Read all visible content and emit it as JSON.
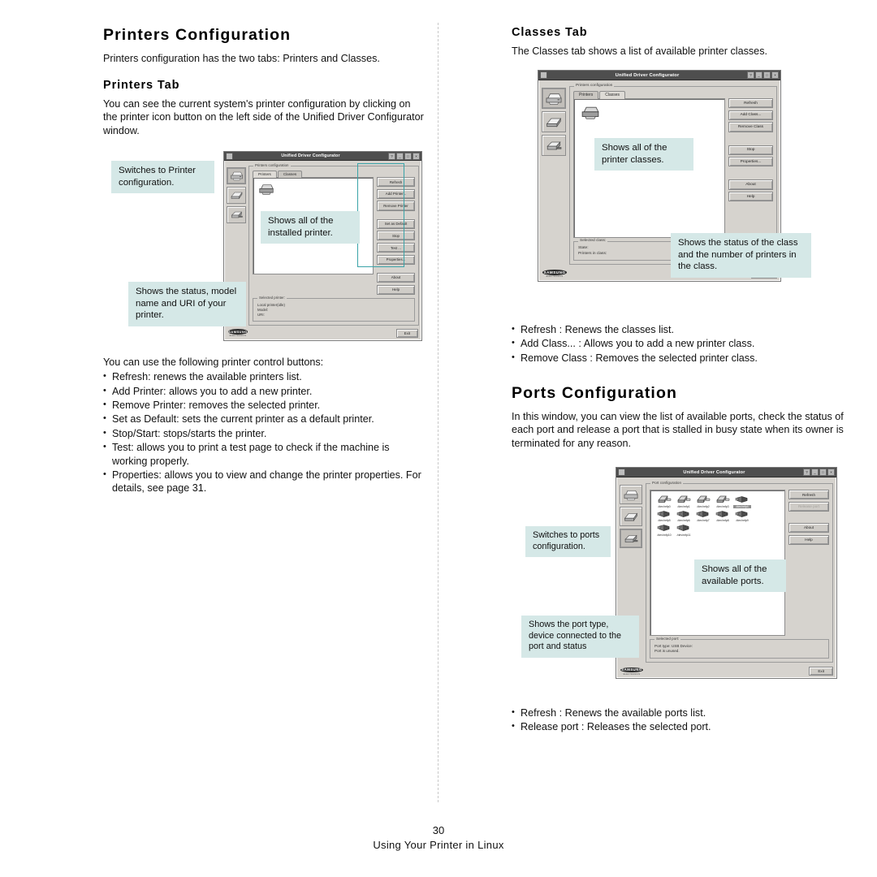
{
  "page": {
    "number": "30",
    "footer_title": "Using Your Printer in Linux"
  },
  "left_column": {
    "heading": "Printers Configuration",
    "intro": "Printers configuration has the two tabs: Printers and Classes.",
    "subheading": "Printers Tab",
    "paragraph": "You can see the current system's printer configuration by clicking on the printer icon button on the left side of the Unified Driver Configurator window.",
    "buttons_intro": "You can use the following printer control buttons:",
    "button_list": [
      "Refresh: renews the available printers list.",
      "Add Printer: allows you to add a new printer.",
      "Remove Printer: removes the selected printer.",
      "Set as Default: sets the current printer as a default printer.",
      "Stop/Start: stops/starts the printer.",
      "Test: allows you to print a test page to check if the machine is working properly.",
      "Properties: allows you to view and change the printer properties. For details, see page 31."
    ]
  },
  "right_column": {
    "classes_heading": "Classes Tab",
    "classes_intro": "The Classes tab shows a list of available printer classes.",
    "classes_list": [
      "Refresh : Renews the classes list.",
      "Add Class... : Allows you to add a new printer class.",
      "Remove Class : Removes the selected printer class."
    ],
    "ports_heading": "Ports Configuration",
    "ports_intro": "In this window, you can view the list of available ports, check the status of each port and release a port that is stalled in busy state when its owner is terminated for any reason.",
    "ports_list": [
      "Refresh : Renews the available ports list.",
      "Release port : Releases the selected port."
    ]
  },
  "figure_printers": {
    "window_title": "Unified Driver Configurator",
    "titlebar_buttons": [
      "?",
      "_",
      "□",
      "×"
    ],
    "group_title": "Printers configuration",
    "tabs": [
      {
        "label": "Printers",
        "active": true
      },
      {
        "label": "Classes",
        "active": false
      }
    ],
    "sidebar_icons": [
      "printer-icon",
      "scanner-icon",
      "port-icon"
    ],
    "buttons": [
      "Refresh",
      "Add Printer...",
      "Remove Printer",
      "Set as Default",
      "Stop",
      "Test ...",
      "Properties...",
      "About",
      "Help"
    ],
    "status_title": "Selected printer:",
    "status_lines": [
      "Local printer(idle)",
      "Model:",
      "URI:"
    ],
    "exit_label": "Exit",
    "logo_text": "SAMSUNG",
    "logo_sub": "ELECTRONICS",
    "callouts": [
      "Switches to Printer configuration.",
      "Shows all of the installed printer.",
      "Shows the status, model name and URI of your printer."
    ]
  },
  "figure_classes": {
    "window_title": "Unified Driver Configurator",
    "titlebar_buttons": [
      "?",
      "_",
      "□",
      "×"
    ],
    "group_title": "Printers configuration",
    "tabs": [
      {
        "label": "Printers",
        "active": false
      },
      {
        "label": "Classes",
        "active": true
      }
    ],
    "sidebar_icons": [
      "printer-icon",
      "scanner-icon",
      "port-icon"
    ],
    "buttons": [
      "Refresh",
      "Add Class...",
      "Remove Class",
      "Stop",
      "Properties...",
      "About",
      "Help"
    ],
    "status_title": "Selected class:",
    "status_lines": [
      "State:",
      "Printers in class:"
    ],
    "exit_label": "Exit",
    "logo_text": "SAMSUNG",
    "logo_sub": "ELECTRONICS",
    "callouts": [
      "Shows all of the printer classes.",
      "Shows the status of the class and the number of printers in the class."
    ]
  },
  "figure_ports": {
    "window_title": "Unified Driver Configurator",
    "titlebar_buttons": [
      "?",
      "_",
      "□",
      "×"
    ],
    "group_title": "Port configuration",
    "sidebar_icons": [
      "printer-icon",
      "scanner-icon",
      "port-icon"
    ],
    "buttons": [
      "Refresh",
      "Release port",
      "About",
      "Help"
    ],
    "disabled_button": "Release port",
    "ports": [
      {
        "label": "/dev/mfp0",
        "type": "parallel",
        "selected": false
      },
      {
        "label": "/dev/mfp1",
        "type": "parallel",
        "selected": false
      },
      {
        "label": "/dev/mfp2",
        "type": "parallel",
        "selected": false
      },
      {
        "label": "/dev/mfp3",
        "type": "parallel",
        "selected": false
      },
      {
        "label": "/dev/mfp4",
        "type": "usb",
        "selected": true
      },
      {
        "label": "/dev/mfp5",
        "type": "usb",
        "selected": false
      },
      {
        "label": "/dev/mfp6",
        "type": "usb",
        "selected": false
      },
      {
        "label": "/dev/mfp7",
        "type": "usb",
        "selected": false
      },
      {
        "label": "/dev/mfp8",
        "type": "usb",
        "selected": false
      },
      {
        "label": "/dev/mfp9",
        "type": "usb",
        "selected": false
      },
      {
        "label": "/dev/mfp10",
        "type": "usb",
        "selected": false
      },
      {
        "label": "/dev/mfp11",
        "type": "usb",
        "selected": false
      }
    ],
    "status_title": "Selected port:",
    "status_lines": [
      "Port type: USB   Device:",
      "Port is unused."
    ],
    "exit_label": "Exit",
    "logo_text": "SAMSUNG",
    "logo_sub": "ELECTRONICS",
    "callouts": [
      "Switches to ports configuration.",
      "Shows all of the available ports.",
      "Shows the port type, device connected to the port and status"
    ]
  },
  "colors": {
    "callout_bg": "#d5e8e7",
    "highlight_border": "#3aa3a8",
    "titlebar": "#4e4e4e",
    "window_face": "#d6d3ce"
  }
}
